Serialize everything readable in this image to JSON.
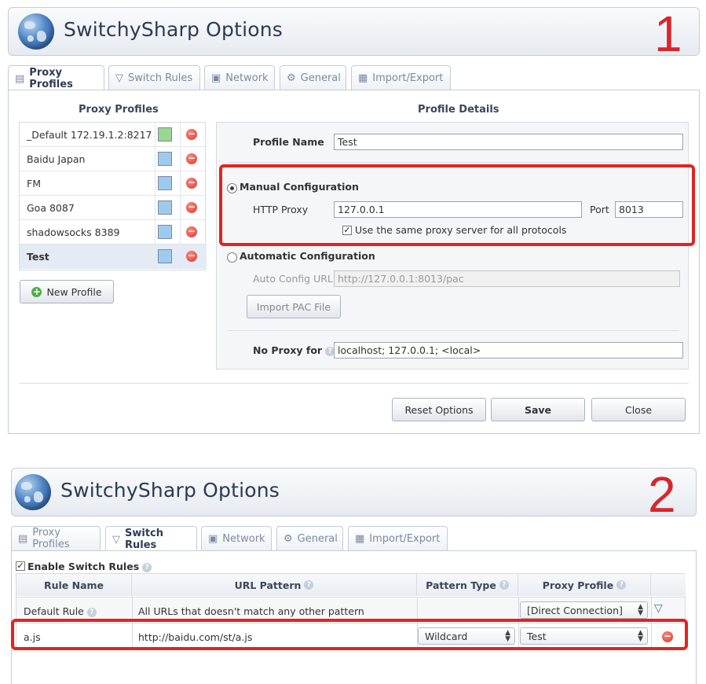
{
  "panel1": {
    "title": "SwitchySharp Options",
    "number": "1",
    "tabs": [
      "Proxy Profiles",
      "Switch Rules",
      "Network",
      "General",
      "Import/Export"
    ],
    "profiles_heading": "Proxy Profiles",
    "details_heading": "Profile Details",
    "profiles": [
      {
        "name": "_Default 172.19.1.2:8217",
        "color": "#9ad68f"
      },
      {
        "name": "Baidu Japan",
        "color": "#9ecbed"
      },
      {
        "name": "FM",
        "color": "#9ecbed"
      },
      {
        "name": "Goa 8087",
        "color": "#9ecbed"
      },
      {
        "name": "shadowsocks 8389",
        "color": "#9ecbed"
      },
      {
        "name": "Test",
        "color": "#9ecbed"
      }
    ],
    "new_profile_label": "New Profile",
    "profile_name_label": "Profile Name",
    "profile_name_value": "Test",
    "manual_config_label": "Manual Configuration",
    "http_proxy_label": "HTTP Proxy",
    "http_proxy_value": "127.0.0.1",
    "port_label": "Port",
    "port_value": "8013",
    "same_proxy_label": "Use the same proxy server for all protocols",
    "auto_config_label": "Automatic Configuration",
    "auto_config_url_label": "Auto Config URL",
    "auto_config_url_value": "http://127.0.0.1:8013/pac",
    "import_pac_label": "Import PAC File",
    "no_proxy_label": "No Proxy for",
    "no_proxy_value": "localhost; 127.0.0.1; <local>",
    "buttons": {
      "reset": "Reset Options",
      "save": "Save",
      "close": "Close"
    }
  },
  "panel2": {
    "title": "SwitchySharp Options",
    "number": "2",
    "tabs": [
      "Proxy Profiles",
      "Switch Rules",
      "Network",
      "General",
      "Import/Export"
    ],
    "enable_label": "Enable Switch Rules",
    "columns": [
      "Rule Name",
      "URL Pattern",
      "Pattern Type",
      "Proxy Profile"
    ],
    "default_rule": {
      "name": "Default Rule",
      "pattern": "All URLs that doesn't match any other pattern",
      "profile": "[Direct Connection]"
    },
    "rules": [
      {
        "name": "a.js",
        "pattern": "http://baidu.com/st/a.js",
        "type": "Wildcard",
        "profile": "Test"
      }
    ]
  },
  "colors": {
    "accent_red": "#e22320",
    "title_text": "#2e3a52"
  }
}
